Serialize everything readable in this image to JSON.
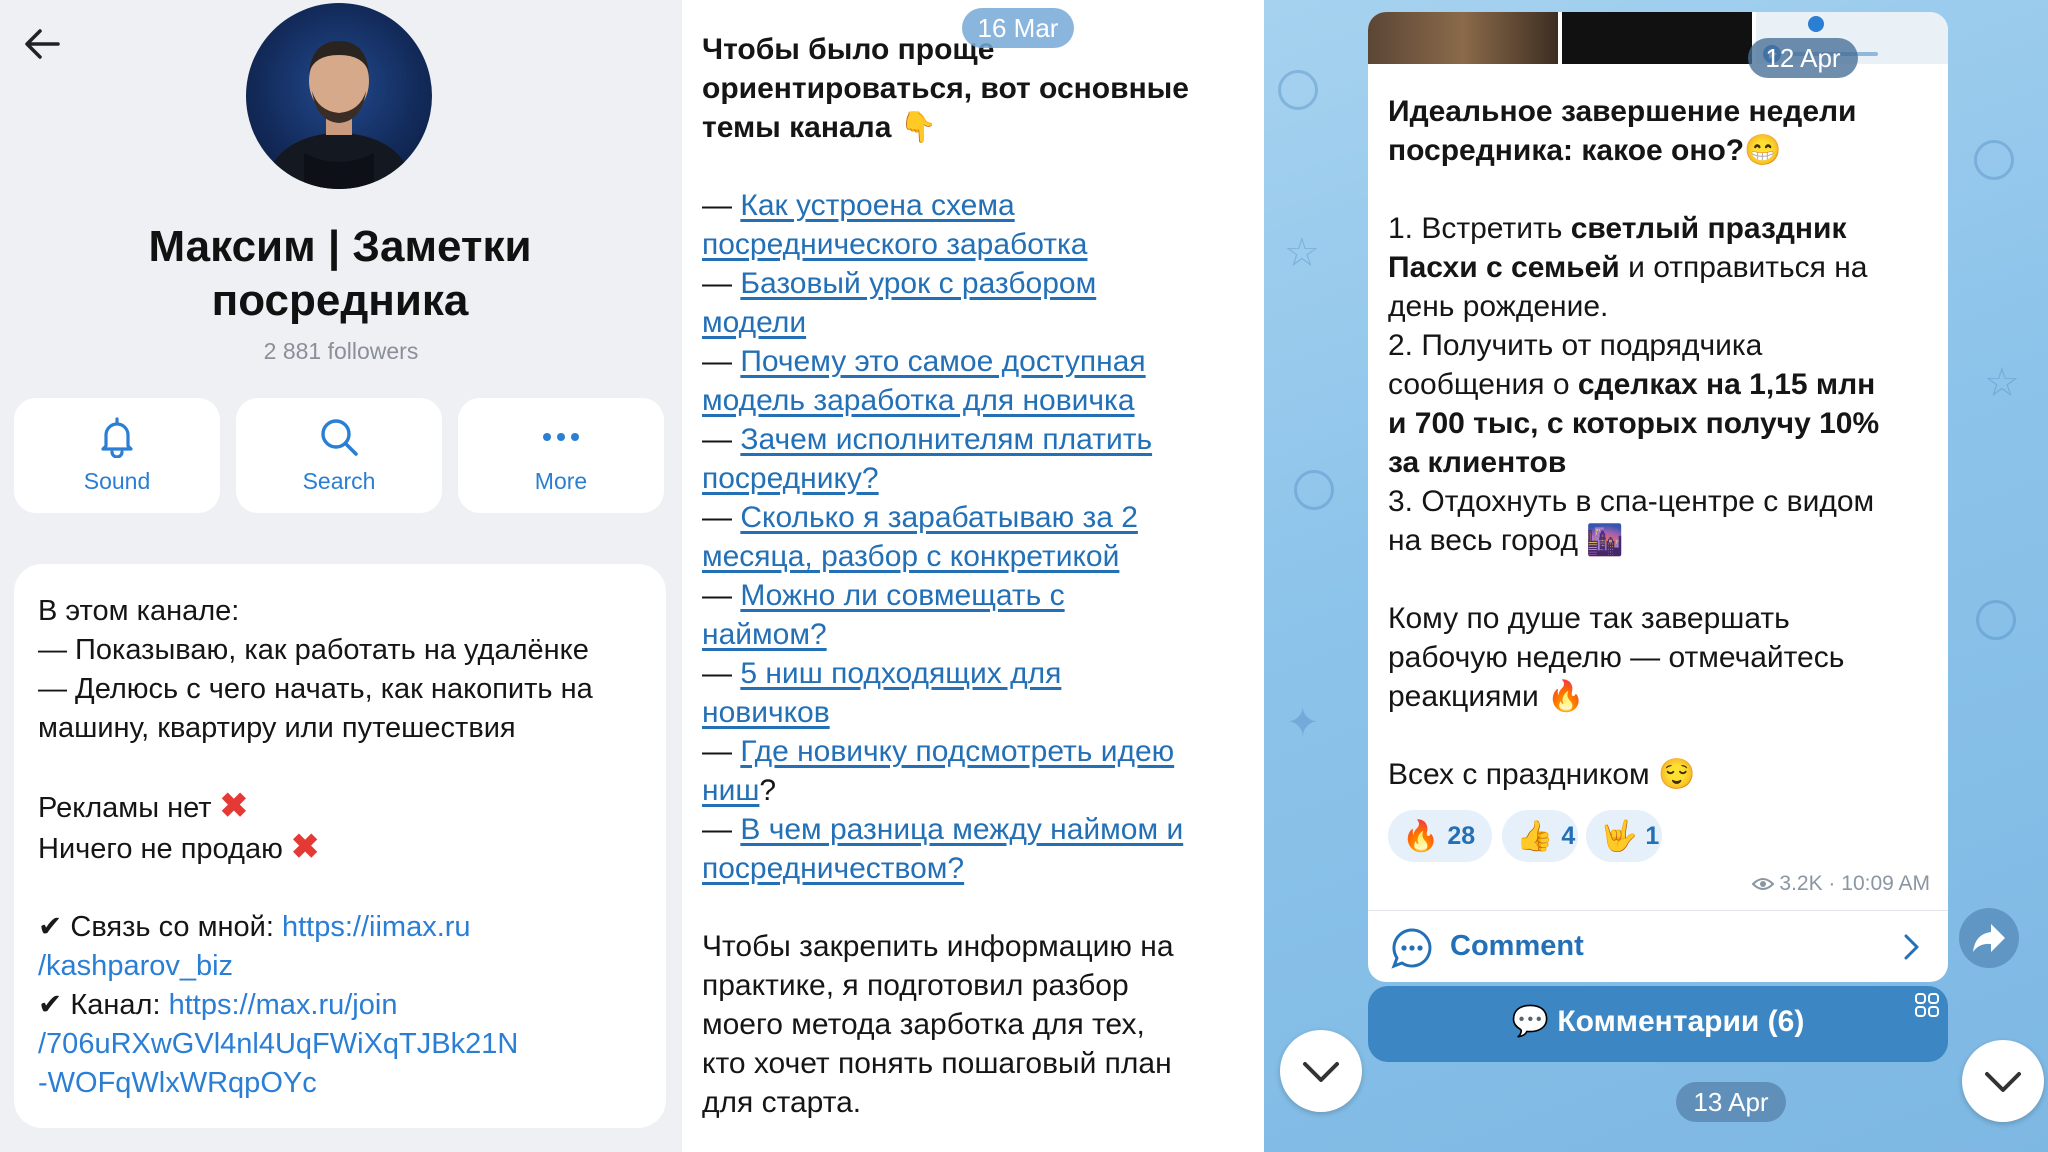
{
  "profile": {
    "title_line1": "Максим | Заметки",
    "title_line2": "посредника",
    "followers": "2 881 followers",
    "actions": {
      "sound": "Sound",
      "search": "Search",
      "more": "More"
    },
    "about": {
      "l1": "В этом канале:",
      "l2": "— Показываю, как работать на удалёнке",
      "l3": "— Делюсь с чего начать, как накопить на",
      "l4": "машину, квартиру или путешествия",
      "no_ads": "Рекламы нет",
      "no_sell": "Ничего не продаю",
      "contact_label": "Связь со мной: ",
      "contact_link_1": "https://iimax.ru",
      "contact_link_2": "/kashparov_biz",
      "channel_label": "Канал: ",
      "channel_link_1": "https://max.ru/join",
      "channel_link_2": "/706uRXwGVl4nl4UqFWiXqTJBk21N",
      "channel_link_3": "-WOFqWlxWRqpOYc"
    }
  },
  "topics_post": {
    "date": "16 Mar",
    "h1": "Чтобы было проще",
    "h2": "ориентироваться, вот основные",
    "h3": "темы канала 👇",
    "links": [
      [
        "Как устроена схема",
        "посреднического заработка"
      ],
      [
        "Базовый урок с разбором",
        "модели"
      ],
      [
        "Почему это самое доступная",
        "модель заработка для новичка"
      ],
      [
        "Зачем исполнителям платить",
        "посреднику?"
      ],
      [
        "Сколько я зарабатываю за 2",
        "месяца, разбор с конкретикой"
      ],
      [
        "Можно ли совмещать с",
        "наймом?"
      ],
      [
        "5 ниш подходящих для",
        "новичков"
      ],
      [
        "Где новичку подсмотреть идею",
        "ниш"
      ],
      [
        "В чем разница между наймом и",
        "посредничеством?"
      ]
    ],
    "p1": "Чтобы закрепить информацию на",
    "p2": "практике, я подготовил разбор",
    "p3": "моего метода зарботка для тех,",
    "p4": "кто хочет понять пошаговый план",
    "p5": "для старта."
  },
  "chat_post": {
    "date": "12 Apr",
    "t1": "Идеальное завершение недели",
    "t2": "посредника: какое оно?😁",
    "i1a": "1. Встретить ",
    "i1b": "светлый праздник",
    "i2a": "Пасхи с семьей",
    "i2b": " и отправиться на",
    "i3": "день рождение.",
    "i4": "2. Получить от подрядчика",
    "i5a": "сообщения о ",
    "i5b": "сделках на 1,15 млн",
    "i6": "и 700 тыс, с которых получу 10%",
    "i7": "за клиентов",
    "i8": "3. Отдохнуть в спа-центре с видом",
    "i9": "на весь город 🌆",
    "q1": "Кому по душе так завершать",
    "q2": "рабочую неделю — отмечайтесь",
    "q3": "реакциями 🔥",
    "end": "Всех с праздником 😌",
    "reactions": [
      {
        "emoji": "🔥",
        "count": "28"
      },
      {
        "emoji": "👍",
        "count": "4"
      },
      {
        "emoji": "🤟",
        "count": "1"
      }
    ],
    "views": "3.2K",
    "time": "10:09 AM",
    "comment_label": "Comment",
    "comments_button": "💬 Комментарии (6)",
    "next_date": "13 Apr"
  },
  "colors": {
    "link": "#2370b6",
    "accent": "#2a7ed3",
    "chat_bg": "#8cc3ea"
  }
}
